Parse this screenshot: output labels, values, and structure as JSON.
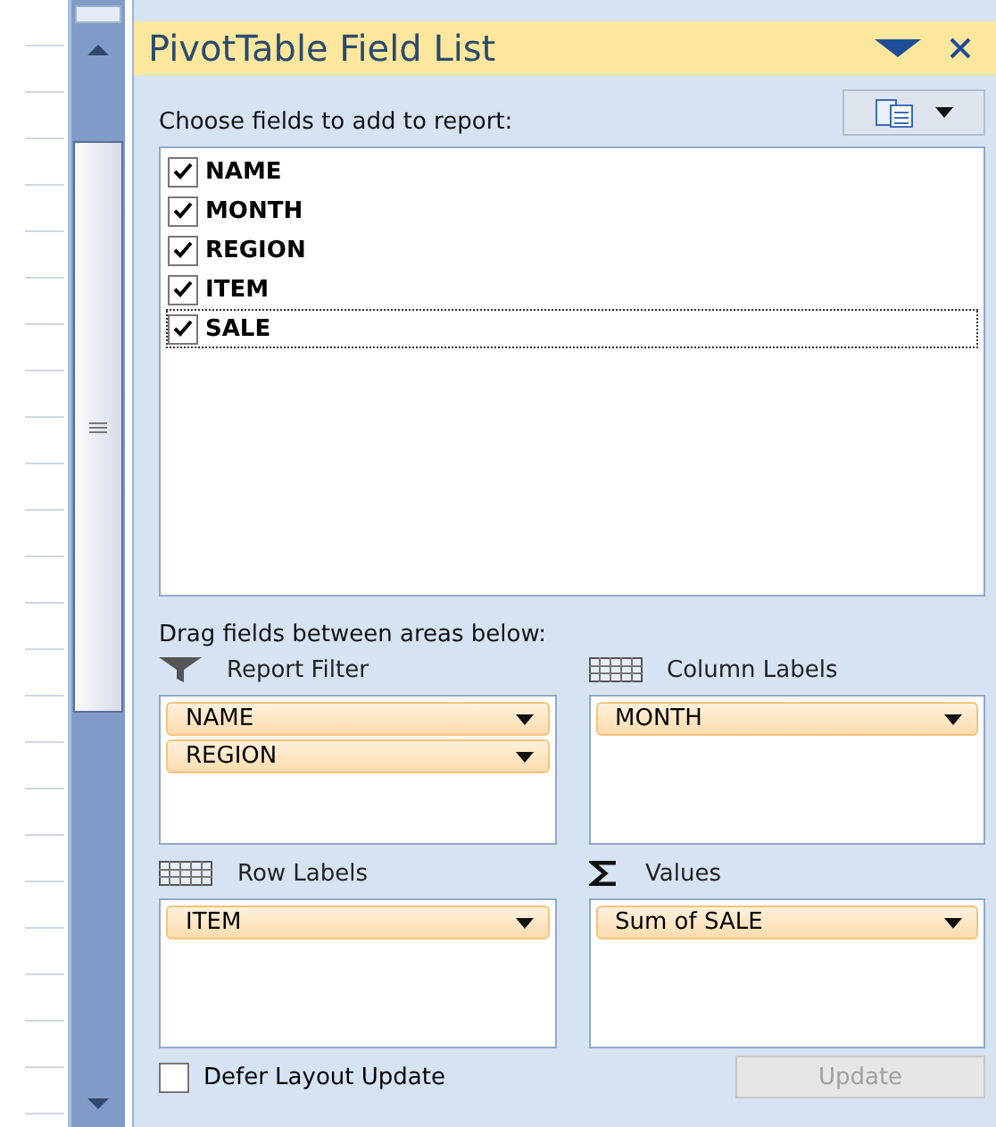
{
  "panel": {
    "title": "PivotTable Field List"
  },
  "fields_prompt": "Choose fields to add to report:",
  "fields": [
    {
      "label": "NAME",
      "checked": true,
      "selected": false
    },
    {
      "label": "MONTH",
      "checked": true,
      "selected": false
    },
    {
      "label": "REGION",
      "checked": true,
      "selected": false
    },
    {
      "label": "ITEM",
      "checked": true,
      "selected": false
    },
    {
      "label": "SALE",
      "checked": true,
      "selected": true
    }
  ],
  "areas_prompt": "Drag fields between areas below:",
  "areas": [
    {
      "kind": "filter",
      "title": "Report Filter",
      "items": [
        "NAME",
        "REGION"
      ]
    },
    {
      "kind": "columns",
      "title": "Column Labels",
      "items": [
        "MONTH"
      ]
    },
    {
      "kind": "rows",
      "title": "Row Labels",
      "items": [
        "ITEM"
      ]
    },
    {
      "kind": "values",
      "title": "Values",
      "items": [
        "Sum of SALE"
      ]
    }
  ],
  "defer": {
    "label": "Defer Layout Update",
    "checked": false
  },
  "update_button": {
    "label": "Update",
    "disabled": true
  }
}
